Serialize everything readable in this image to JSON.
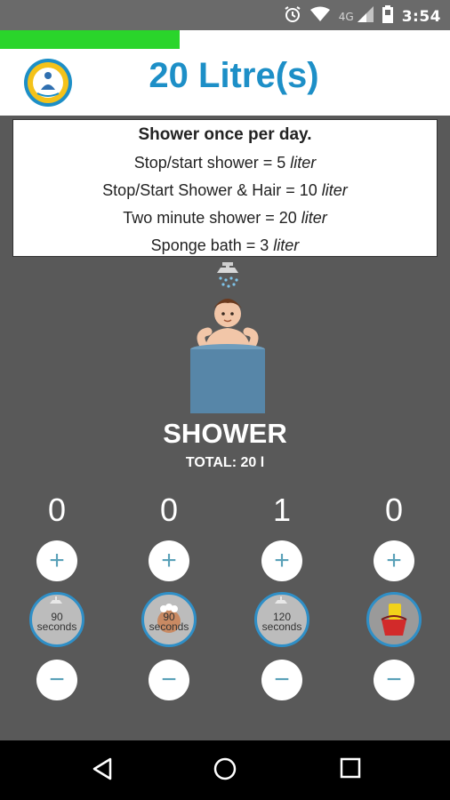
{
  "status": {
    "network": "4G",
    "time": "3:54"
  },
  "progress": {
    "fraction": 0.4
  },
  "header": {
    "title": "20 Litre(s)"
  },
  "info": {
    "title": "Shower once per day.",
    "lines": [
      {
        "text": "Stop/start shower = 5 ",
        "unit": "liter"
      },
      {
        "text": "Stop/Start Shower & Hair = 10 ",
        "unit": "liter"
      },
      {
        "text": "Two minute shower = 20 ",
        "unit": "liter"
      },
      {
        "text": "Sponge bath = 3 ",
        "unit": "liter"
      }
    ]
  },
  "activity": {
    "title": "SHOWER",
    "total": "TOTAL: 20 l"
  },
  "options": [
    {
      "count": "0",
      "num": "90",
      "label": "seconds"
    },
    {
      "count": "0",
      "num": "90",
      "label": "seconds"
    },
    {
      "count": "1",
      "num": "120",
      "label": "seconds"
    },
    {
      "count": "0",
      "num": "",
      "label": ""
    }
  ],
  "buttons": {
    "plus": "+",
    "minus": "−"
  },
  "colors": {
    "accent": "#1d8fc7",
    "progress": "#2ad52b",
    "background": "#595959"
  },
  "icons": [
    "alarm-icon",
    "wifi-icon",
    "signal-icon",
    "battery-icon",
    "back-icon",
    "home-icon",
    "recents-icon"
  ]
}
